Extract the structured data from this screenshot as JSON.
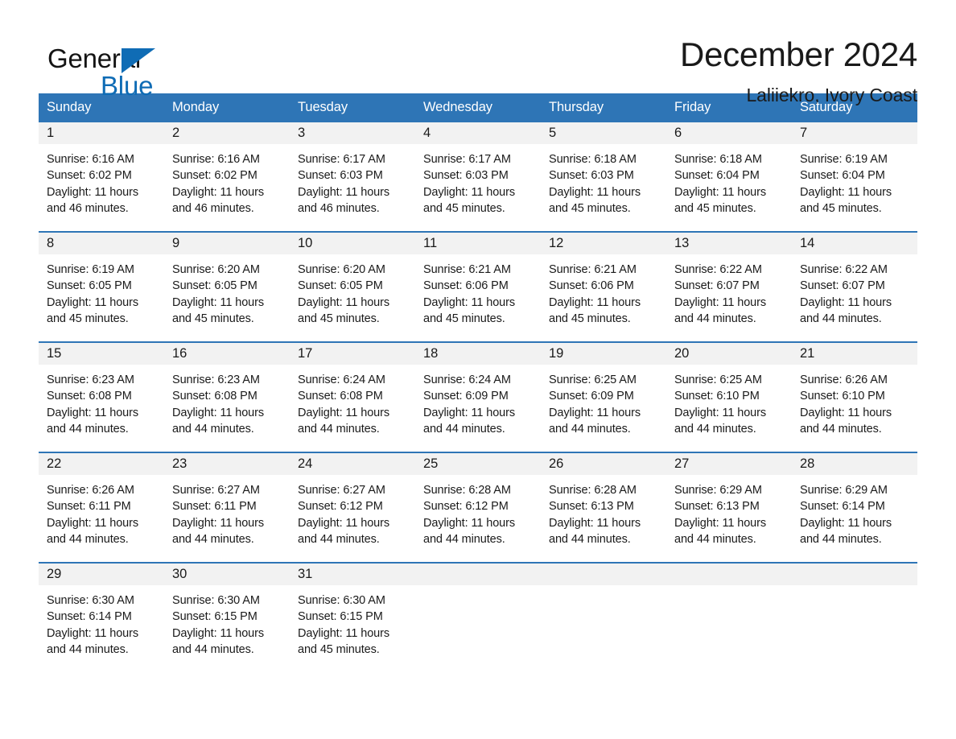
{
  "brand": {
    "name_part1": "General",
    "name_part2": "Blue",
    "triangle_color": "#0f6cb5",
    "accent_color": "#2e75b6"
  },
  "header": {
    "title": "December 2024",
    "subtitle": "Laliiekro, Ivory Coast"
  },
  "calendar": {
    "weekday_headers": [
      "Sunday",
      "Monday",
      "Tuesday",
      "Wednesday",
      "Thursday",
      "Friday",
      "Saturday"
    ],
    "header_bg": "#2e75b6",
    "daynum_bg": "#f2f2f2",
    "weeks": [
      [
        {
          "day": "1",
          "sunrise": "Sunrise: 6:16 AM",
          "sunset": "Sunset: 6:02 PM",
          "daylight_line1": "Daylight: 11 hours",
          "daylight_line2": "and 46 minutes."
        },
        {
          "day": "2",
          "sunrise": "Sunrise: 6:16 AM",
          "sunset": "Sunset: 6:02 PM",
          "daylight_line1": "Daylight: 11 hours",
          "daylight_line2": "and 46 minutes."
        },
        {
          "day": "3",
          "sunrise": "Sunrise: 6:17 AM",
          "sunset": "Sunset: 6:03 PM",
          "daylight_line1": "Daylight: 11 hours",
          "daylight_line2": "and 46 minutes."
        },
        {
          "day": "4",
          "sunrise": "Sunrise: 6:17 AM",
          "sunset": "Sunset: 6:03 PM",
          "daylight_line1": "Daylight: 11 hours",
          "daylight_line2": "and 45 minutes."
        },
        {
          "day": "5",
          "sunrise": "Sunrise: 6:18 AM",
          "sunset": "Sunset: 6:03 PM",
          "daylight_line1": "Daylight: 11 hours",
          "daylight_line2": "and 45 minutes."
        },
        {
          "day": "6",
          "sunrise": "Sunrise: 6:18 AM",
          "sunset": "Sunset: 6:04 PM",
          "daylight_line1": "Daylight: 11 hours",
          "daylight_line2": "and 45 minutes."
        },
        {
          "day": "7",
          "sunrise": "Sunrise: 6:19 AM",
          "sunset": "Sunset: 6:04 PM",
          "daylight_line1": "Daylight: 11 hours",
          "daylight_line2": "and 45 minutes."
        }
      ],
      [
        {
          "day": "8",
          "sunrise": "Sunrise: 6:19 AM",
          "sunset": "Sunset: 6:05 PM",
          "daylight_line1": "Daylight: 11 hours",
          "daylight_line2": "and 45 minutes."
        },
        {
          "day": "9",
          "sunrise": "Sunrise: 6:20 AM",
          "sunset": "Sunset: 6:05 PM",
          "daylight_line1": "Daylight: 11 hours",
          "daylight_line2": "and 45 minutes."
        },
        {
          "day": "10",
          "sunrise": "Sunrise: 6:20 AM",
          "sunset": "Sunset: 6:05 PM",
          "daylight_line1": "Daylight: 11 hours",
          "daylight_line2": "and 45 minutes."
        },
        {
          "day": "11",
          "sunrise": "Sunrise: 6:21 AM",
          "sunset": "Sunset: 6:06 PM",
          "daylight_line1": "Daylight: 11 hours",
          "daylight_line2": "and 45 minutes."
        },
        {
          "day": "12",
          "sunrise": "Sunrise: 6:21 AM",
          "sunset": "Sunset: 6:06 PM",
          "daylight_line1": "Daylight: 11 hours",
          "daylight_line2": "and 45 minutes."
        },
        {
          "day": "13",
          "sunrise": "Sunrise: 6:22 AM",
          "sunset": "Sunset: 6:07 PM",
          "daylight_line1": "Daylight: 11 hours",
          "daylight_line2": "and 44 minutes."
        },
        {
          "day": "14",
          "sunrise": "Sunrise: 6:22 AM",
          "sunset": "Sunset: 6:07 PM",
          "daylight_line1": "Daylight: 11 hours",
          "daylight_line2": "and 44 minutes."
        }
      ],
      [
        {
          "day": "15",
          "sunrise": "Sunrise: 6:23 AM",
          "sunset": "Sunset: 6:08 PM",
          "daylight_line1": "Daylight: 11 hours",
          "daylight_line2": "and 44 minutes."
        },
        {
          "day": "16",
          "sunrise": "Sunrise: 6:23 AM",
          "sunset": "Sunset: 6:08 PM",
          "daylight_line1": "Daylight: 11 hours",
          "daylight_line2": "and 44 minutes."
        },
        {
          "day": "17",
          "sunrise": "Sunrise: 6:24 AM",
          "sunset": "Sunset: 6:08 PM",
          "daylight_line1": "Daylight: 11 hours",
          "daylight_line2": "and 44 minutes."
        },
        {
          "day": "18",
          "sunrise": "Sunrise: 6:24 AM",
          "sunset": "Sunset: 6:09 PM",
          "daylight_line1": "Daylight: 11 hours",
          "daylight_line2": "and 44 minutes."
        },
        {
          "day": "19",
          "sunrise": "Sunrise: 6:25 AM",
          "sunset": "Sunset: 6:09 PM",
          "daylight_line1": "Daylight: 11 hours",
          "daylight_line2": "and 44 minutes."
        },
        {
          "day": "20",
          "sunrise": "Sunrise: 6:25 AM",
          "sunset": "Sunset: 6:10 PM",
          "daylight_line1": "Daylight: 11 hours",
          "daylight_line2": "and 44 minutes."
        },
        {
          "day": "21",
          "sunrise": "Sunrise: 6:26 AM",
          "sunset": "Sunset: 6:10 PM",
          "daylight_line1": "Daylight: 11 hours",
          "daylight_line2": "and 44 minutes."
        }
      ],
      [
        {
          "day": "22",
          "sunrise": "Sunrise: 6:26 AM",
          "sunset": "Sunset: 6:11 PM",
          "daylight_line1": "Daylight: 11 hours",
          "daylight_line2": "and 44 minutes."
        },
        {
          "day": "23",
          "sunrise": "Sunrise: 6:27 AM",
          "sunset": "Sunset: 6:11 PM",
          "daylight_line1": "Daylight: 11 hours",
          "daylight_line2": "and 44 minutes."
        },
        {
          "day": "24",
          "sunrise": "Sunrise: 6:27 AM",
          "sunset": "Sunset: 6:12 PM",
          "daylight_line1": "Daylight: 11 hours",
          "daylight_line2": "and 44 minutes."
        },
        {
          "day": "25",
          "sunrise": "Sunrise: 6:28 AM",
          "sunset": "Sunset: 6:12 PM",
          "daylight_line1": "Daylight: 11 hours",
          "daylight_line2": "and 44 minutes."
        },
        {
          "day": "26",
          "sunrise": "Sunrise: 6:28 AM",
          "sunset": "Sunset: 6:13 PM",
          "daylight_line1": "Daylight: 11 hours",
          "daylight_line2": "and 44 minutes."
        },
        {
          "day": "27",
          "sunrise": "Sunrise: 6:29 AM",
          "sunset": "Sunset: 6:13 PM",
          "daylight_line1": "Daylight: 11 hours",
          "daylight_line2": "and 44 minutes."
        },
        {
          "day": "28",
          "sunrise": "Sunrise: 6:29 AM",
          "sunset": "Sunset: 6:14 PM",
          "daylight_line1": "Daylight: 11 hours",
          "daylight_line2": "and 44 minutes."
        }
      ],
      [
        {
          "day": "29",
          "sunrise": "Sunrise: 6:30 AM",
          "sunset": "Sunset: 6:14 PM",
          "daylight_line1": "Daylight: 11 hours",
          "daylight_line2": "and 44 minutes."
        },
        {
          "day": "30",
          "sunrise": "Sunrise: 6:30 AM",
          "sunset": "Sunset: 6:15 PM",
          "daylight_line1": "Daylight: 11 hours",
          "daylight_line2": "and 44 minutes."
        },
        {
          "day": "31",
          "sunrise": "Sunrise: 6:30 AM",
          "sunset": "Sunset: 6:15 PM",
          "daylight_line1": "Daylight: 11 hours",
          "daylight_line2": "and 45 minutes."
        },
        {
          "day": "",
          "sunrise": "",
          "sunset": "",
          "daylight_line1": "",
          "daylight_line2": ""
        },
        {
          "day": "",
          "sunrise": "",
          "sunset": "",
          "daylight_line1": "",
          "daylight_line2": ""
        },
        {
          "day": "",
          "sunrise": "",
          "sunset": "",
          "daylight_line1": "",
          "daylight_line2": ""
        },
        {
          "day": "",
          "sunrise": "",
          "sunset": "",
          "daylight_line1": "",
          "daylight_line2": ""
        }
      ]
    ]
  }
}
